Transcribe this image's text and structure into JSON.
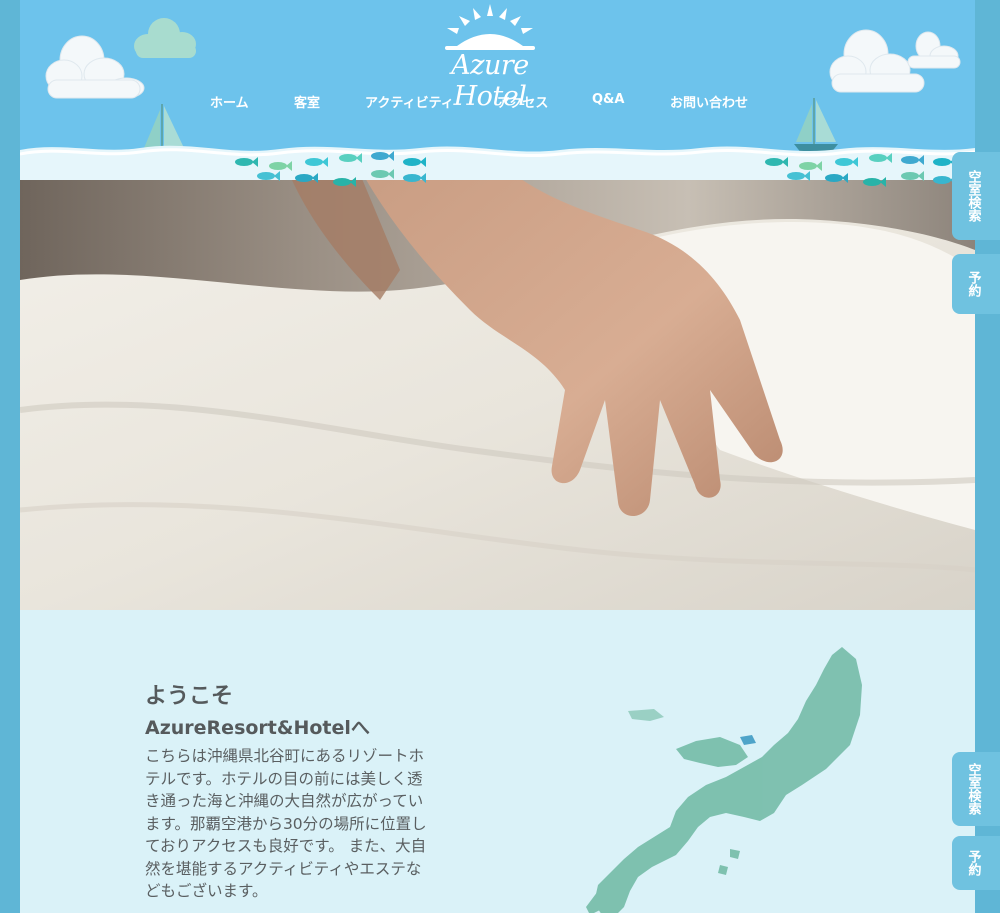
{
  "brand": {
    "logo_text": "Azure Hotel"
  },
  "nav": {
    "items": [
      {
        "label": "ホーム"
      },
      {
        "label": "客室"
      },
      {
        "label": "アクティビティ"
      },
      {
        "label": "アクセス"
      },
      {
        "label": "Q&A"
      },
      {
        "label": "お問い合わせ"
      }
    ]
  },
  "side_tabs": {
    "vacancy_search": "空室検索",
    "reservation": "予約"
  },
  "welcome": {
    "title": "ようこそ",
    "subtitle": "AzureResort&Hotelへ",
    "body": "こちらは沖縄県北谷町にあるリゾートホテルです。ホテルの目の前には美しく透き通った海と沖縄の大自然が広がっています。那覇空港から30分の場所に位置しておりアクセスも良好です。 また、大自然を堪能するアクティビティやエステなどもございます。"
  },
  "colors": {
    "header_sky": "#6dc3ec",
    "page_bg": "#daf2f8",
    "frame": "#5fb6d6",
    "side_tab": "#6fc2e0",
    "text": "#555a5c",
    "map_green": "#6fb9a3"
  }
}
